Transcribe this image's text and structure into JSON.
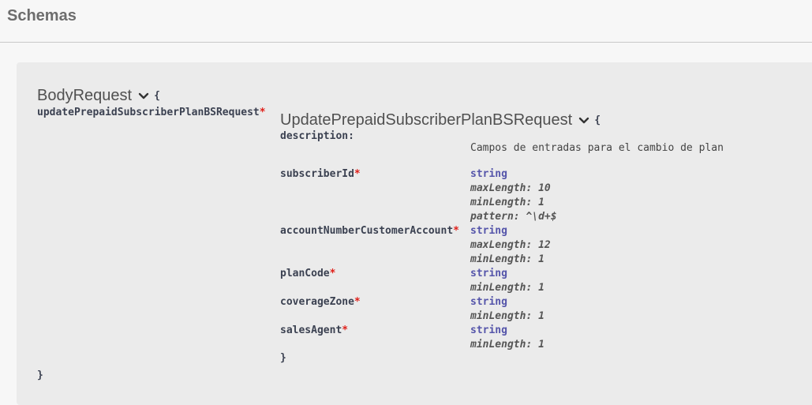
{
  "section": {
    "title": "Schemas"
  },
  "outer_model": {
    "name": "BodyRequest",
    "open_brace": "{",
    "close_brace": "}",
    "property": {
      "name": "updatePrepaidSubscriberPlanBSRequest",
      "required_mark": "*"
    }
  },
  "inner_model": {
    "name": "UpdatePrepaidSubscriberPlanBSRequest",
    "open_brace": "{",
    "close_brace": "}",
    "description_label": "description:",
    "description_value": "Campos de entradas para el cambio de plan",
    "properties": [
      {
        "name": "subscriberId",
        "required_mark": "*",
        "type": "string",
        "constraints": [
          "maxLength: 10",
          "minLength: 1",
          "pattern: ^\\d+$"
        ]
      },
      {
        "name": "accountNumberCustomerAccount",
        "required_mark": "*",
        "type": "string",
        "constraints": [
          "maxLength: 12",
          "minLength: 1"
        ]
      },
      {
        "name": "planCode",
        "required_mark": "*",
        "type": "string",
        "constraints": [
          "minLength: 1"
        ]
      },
      {
        "name": "coverageZone",
        "required_mark": "*",
        "type": "string",
        "constraints": [
          "minLength: 1"
        ]
      },
      {
        "name": "salesAgent",
        "required_mark": "*",
        "type": "string",
        "constraints": [
          "minLength: 1"
        ]
      }
    ]
  },
  "icons": {
    "collapse": "chevron-down-icon"
  },
  "colors": {
    "background": "#f7f7f7",
    "model_box": "#ebebeb",
    "required": "#e0201a",
    "type": "#5555aa",
    "text": "#3b4151"
  }
}
